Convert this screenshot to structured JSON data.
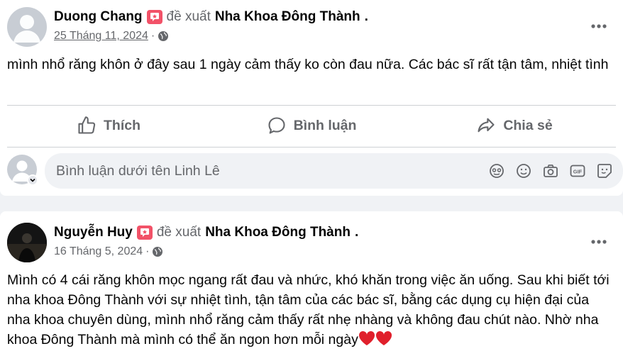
{
  "posts": [
    {
      "author": "Duong Chang",
      "verb": "đề xuất",
      "page": "Nha Khoa Đông Thành",
      "date": "25 Tháng 11, 2024",
      "dot": "·",
      "text": "mình nhổ răng khôn ở đây sau 1 ngày cảm thấy ko còn đau nữa. Các bác sĩ rất tận tâm, nhiệt tình",
      "actions": {
        "like": "Thích",
        "comment": "Bình luận",
        "share": "Chia sẻ"
      },
      "comment_placeholder": "Bình luận dưới tên Linh Lê"
    },
    {
      "author": "Nguyễn Huy",
      "verb": "đề xuất",
      "page": "Nha Khoa Đông Thành",
      "date": "16 Tháng 5, 2024",
      "dot": "·",
      "text": "Mình có 4 cái răng khôn mọc ngang rất đau và nhức, khó khăn trong việc ăn uống. Sau khi biết tới nha khoa Đông Thành với sự nhiệt tình, tận tâm của các bác sĩ, bằng các dụng cụ hiện đại của nha khoa chuyên dùng, mình nhổ răng cảm thấy rất nhẹ nhàng và không đau chút nào. Nhờ nha khoa Đông Thành mà mình có thể ăn ngon hơn mỗi ngày",
      "emoji": [
        "red-heart",
        "red-heart"
      ]
    }
  ],
  "colors": {
    "secondary_text": "#65676b",
    "badge": "#f25268",
    "background": "#f0f2f5"
  }
}
